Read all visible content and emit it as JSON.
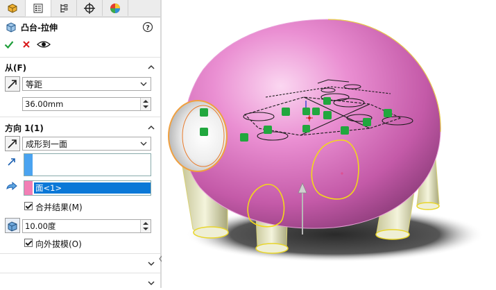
{
  "feature": {
    "title": "凸台-拉伸"
  },
  "from": {
    "header": "从(F)",
    "condition": "等距",
    "distance": "36.00mm"
  },
  "direction1": {
    "header": "方向 1(1)",
    "end_condition": "成形到一面",
    "face_selection": "面<1>",
    "merge_result_label": "合并结果(M)",
    "merge_result_checked": true,
    "draft_angle": "10.00度",
    "draft_outward_label": "向外拔模(O)",
    "draft_outward_checked": true
  },
  "colors": {
    "accent_blue": "#1a73d9",
    "selection_highlight": "#0a78d7",
    "green_check": "#1f9e3a",
    "red_x": "#d8191a",
    "body_pink": "#e37dc6"
  },
  "icons": [
    "feature-manager-icon",
    "property-manager-icon",
    "configuration-manager-icon",
    "dim-expert-icon",
    "display-manager-icon",
    "help-icon",
    "ok-icon",
    "cancel-icon",
    "preview-icon"
  ]
}
